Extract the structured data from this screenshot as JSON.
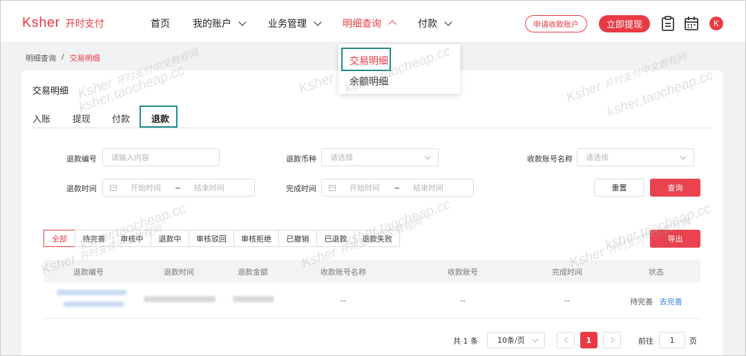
{
  "header": {
    "logo_en": "Ksher",
    "logo_cn": "开时支付",
    "nav": [
      {
        "label": "首页"
      },
      {
        "label": "我的账户"
      },
      {
        "label": "业务管理"
      },
      {
        "label": "明细查询"
      },
      {
        "label": "付款"
      }
    ],
    "apply_button": "申请收款账户",
    "withdraw_button": "立即提现",
    "avatar_letter": "K",
    "accent_color": "#e83a45"
  },
  "dropdown": {
    "items": [
      {
        "label": "交易明细"
      },
      {
        "label": "余额明细"
      }
    ]
  },
  "breadcrumb": {
    "parent": "明细查询",
    "separator": "/",
    "current": "交易明细"
  },
  "card": {
    "title": "交易明细",
    "tabs": [
      {
        "label": "入账"
      },
      {
        "label": "提现"
      },
      {
        "label": "付款"
      },
      {
        "label": "退款"
      }
    ]
  },
  "form": {
    "refund_no_label": "退款编号",
    "refund_no_placeholder": "请输入内容",
    "currency_label": "退款币种",
    "currency_placeholder": "请选择",
    "account_name_label": "收款账号名称",
    "account_name_placeholder": "请选择",
    "refund_time_label": "退款时间",
    "complete_time_label": "完成时间",
    "start_placeholder": "开始时间",
    "range_sep": "~",
    "end_placeholder": "结束时间",
    "reset_button": "重置",
    "search_button": "查询",
    "export_button": "导出"
  },
  "status_filters": [
    {
      "label": "全部"
    },
    {
      "label": "待完善"
    },
    {
      "label": "审核中"
    },
    {
      "label": "退款中"
    },
    {
      "label": "审核驳回"
    },
    {
      "label": "审核拒绝"
    },
    {
      "label": "已撤销"
    },
    {
      "label": "已退款"
    },
    {
      "label": "退款失败"
    }
  ],
  "table": {
    "columns": [
      "退款编号",
      "退款时间",
      "退款金额",
      "收款账号名称",
      "收款账号",
      "完成时间",
      "状态"
    ],
    "rows": [
      {
        "account_name": "--",
        "account": "--",
        "complete_time": "--",
        "status": "待完善",
        "action": "去完善"
      }
    ]
  },
  "pagination": {
    "total": "共 1 条",
    "page_size": "10条/页",
    "current_page": "1",
    "goto_prefix": "前往",
    "goto_value": "1",
    "goto_suffix": "页"
  },
  "watermark": {
    "text_cn": "开时支付中文教程网",
    "text_en": "ksher.taocheap.cc",
    "brand": "Ksher"
  }
}
